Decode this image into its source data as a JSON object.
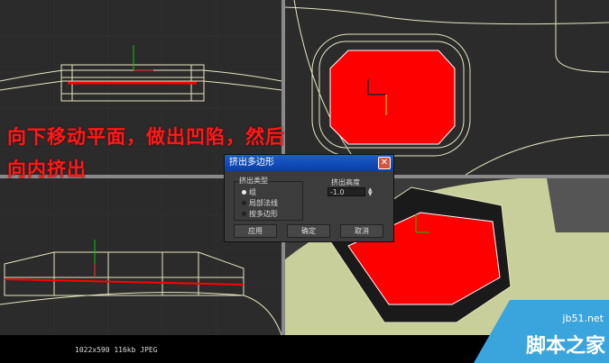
{
  "annotation": {
    "line1": "向下移动平面，做出凹陷，然后",
    "line2": "向内挤出"
  },
  "dialog": {
    "title": "挤出多边形",
    "close_icon": "close-icon",
    "extrude_type": {
      "label": "挤出类型",
      "options": [
        "组",
        "局部法线",
        "按多边形"
      ],
      "selected": "组"
    },
    "extrude_height": {
      "label": "挤出高度",
      "value": "-1.0"
    },
    "buttons": {
      "apply": "应用",
      "ok": "确定",
      "cancel": "取消"
    }
  },
  "status": {
    "info": "1022x590 116kb JPEG"
  },
  "watermark": {
    "domain": "jb51.net",
    "name": "脚本之家"
  },
  "colors": {
    "face": "#ff0000",
    "wire": "#e8e6c0",
    "shaded": "#c9cf9a",
    "viewport": "#2b2b2b"
  }
}
